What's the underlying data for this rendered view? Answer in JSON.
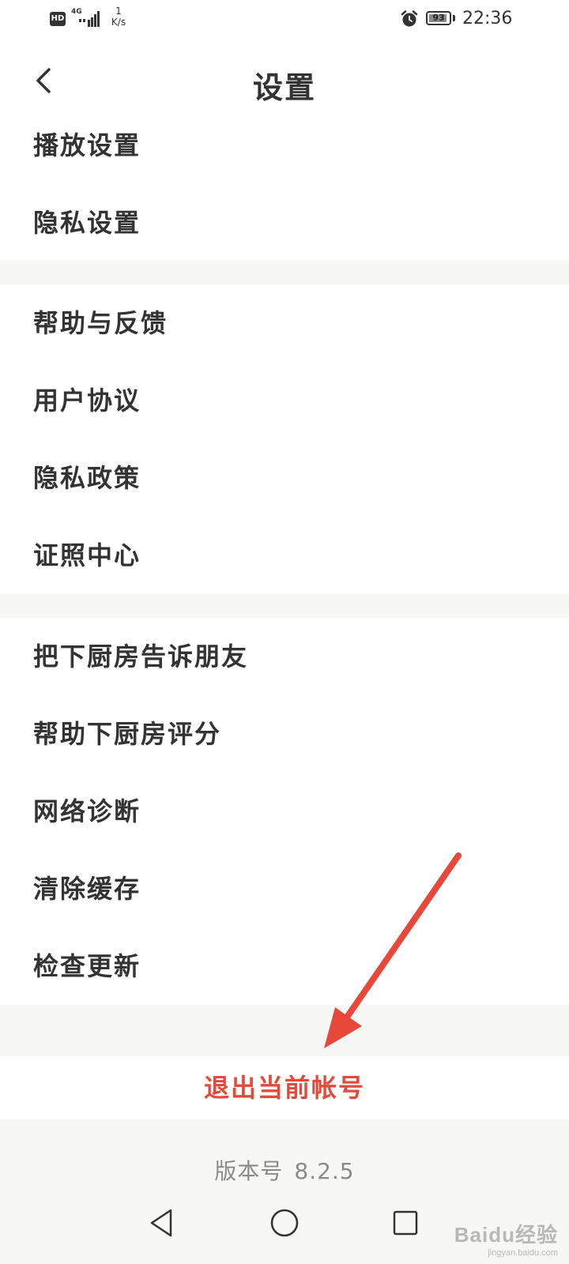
{
  "status_bar": {
    "hd_label": "HD",
    "network_type": "4G",
    "net_speed_value": "1",
    "net_speed_unit": "K/s",
    "battery_level": "93",
    "time": "22:36"
  },
  "header": {
    "title": "设置"
  },
  "groups": [
    {
      "items": [
        "播放设置",
        "隐私设置"
      ]
    },
    {
      "items": [
        "帮助与反馈",
        "用户协议",
        "隐私政策",
        "证照中心"
      ]
    },
    {
      "items": [
        "把下厨房告诉朋友",
        "帮助下厨房评分",
        "网络诊断",
        "清除缓存",
        "检查更新"
      ]
    }
  ],
  "logout": {
    "label": "退出当前帐号",
    "color": "#e24a3b"
  },
  "version": {
    "label": "版本号",
    "number": "8.2.5"
  },
  "annotation": {
    "arrow_color": "#e8483a"
  },
  "watermark": {
    "main": "Baidu经验",
    "sub": "jingyan.baidu.com"
  },
  "icons": {
    "back": "chevron-left-icon",
    "alarm": "alarm-icon",
    "signal": "signal-icon",
    "nav_back": "triangle-back-icon",
    "nav_home": "circle-home-icon",
    "nav_recent": "square-recent-icon"
  }
}
